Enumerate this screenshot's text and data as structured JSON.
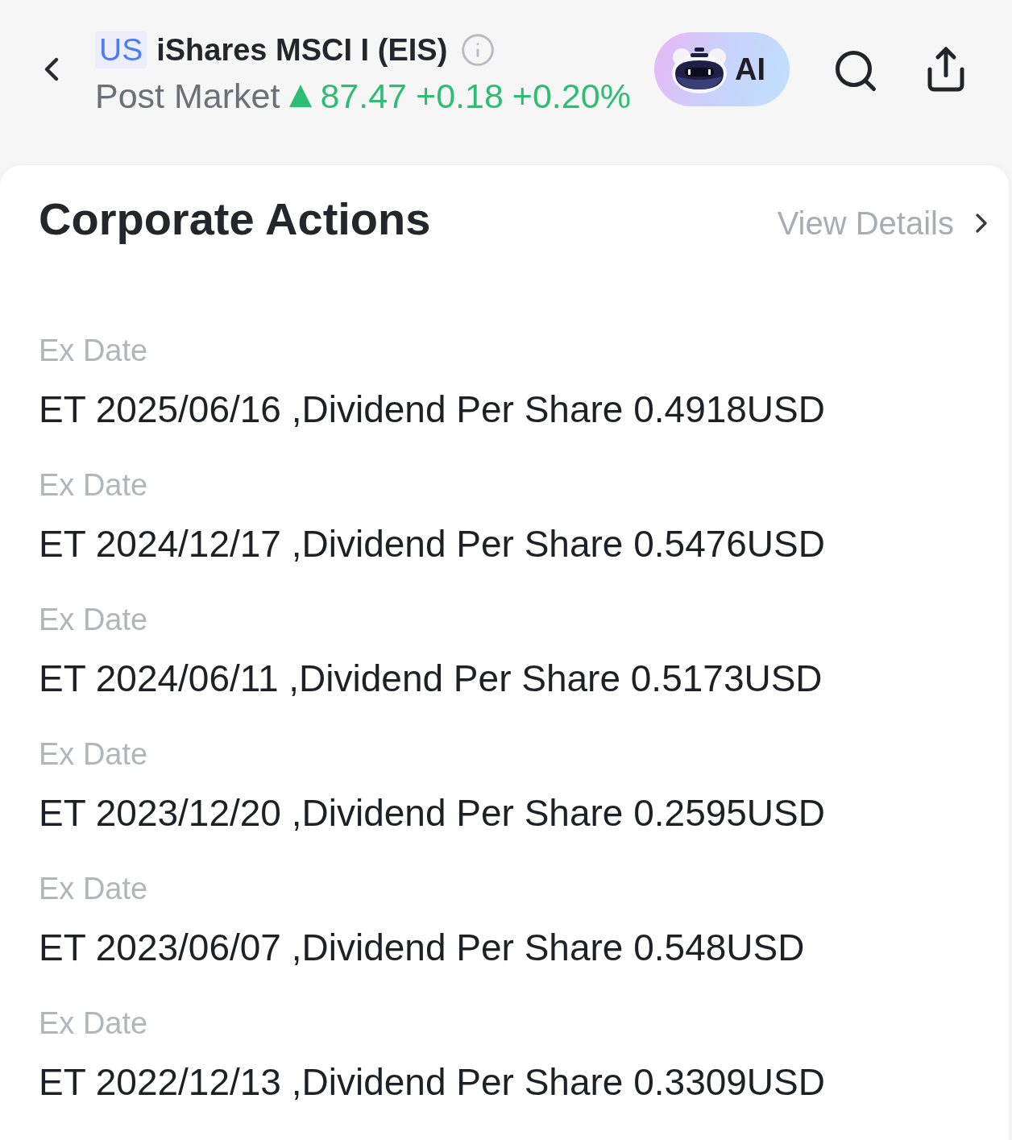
{
  "header": {
    "market_badge": "US",
    "title": "iShares MSCI I (EIS)",
    "session": "Post Market",
    "rising": true,
    "price": "87.47",
    "change": "+0.18",
    "change_percent": "+0.20%",
    "ai_button": "AI"
  },
  "section": {
    "title": "Corporate Actions",
    "link": "View Details",
    "rows": [
      {
        "label": "Ex Date",
        "value": "ET 2025/06/16 ,Dividend Per Share 0.4918USD"
      },
      {
        "label": "Ex Date",
        "value": "ET 2024/12/17 ,Dividend Per Share 0.5476USD"
      },
      {
        "label": "Ex Date",
        "value": "ET 2024/06/11 ,Dividend Per Share 0.5173USD"
      },
      {
        "label": "Ex Date",
        "value": "ET 2023/12/20 ,Dividend Per Share 0.2595USD"
      },
      {
        "label": "Ex Date",
        "value": "ET 2023/06/07 ,Dividend Per Share 0.548USD"
      },
      {
        "label": "Ex Date",
        "value": "ET 2022/12/13 ,Dividend Per Share 0.3309USD"
      }
    ]
  }
}
